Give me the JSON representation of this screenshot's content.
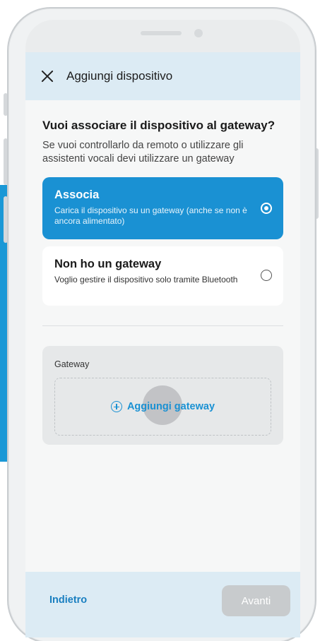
{
  "header": {
    "title": "Aggiungi dispositivo",
    "close_icon": "close-icon"
  },
  "main": {
    "question": "Vuoi associare il dispositivo al gateway?",
    "subtitle": "Se vuoi controllarlo da remoto o utilizzare gli assistenti vocali devi utilizzare un gateway",
    "options": [
      {
        "title": "Associa",
        "description": "Carica il dispositivo su un gateway (anche se non è ancora alimentato)",
        "selected": true
      },
      {
        "title": "Non ho un gateway",
        "description": "Voglio gestire il dispositivo solo tramite Bluetooth",
        "selected": false
      }
    ],
    "gateway": {
      "label": "Gateway",
      "add_label": "Aggiungi gateway",
      "add_icon": "plus-circle-icon"
    }
  },
  "footer": {
    "back_label": "Indietro",
    "next_label": "Avanti",
    "next_enabled": false
  },
  "colors": {
    "accent": "#1a91d3",
    "header_bg": "#dcebf4",
    "disabled_button": "#c8cbcd"
  }
}
